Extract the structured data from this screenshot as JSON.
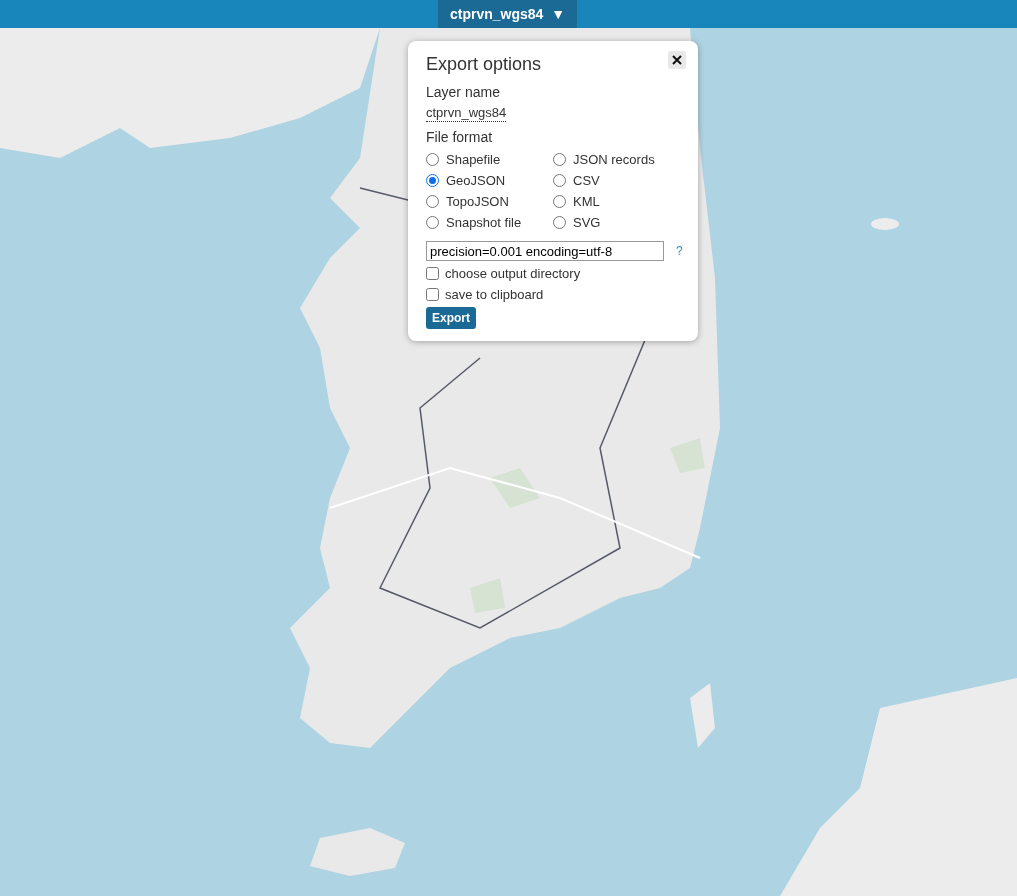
{
  "top_bar": {
    "layer_name": "ctprvn_wgs84",
    "menu_caret": "▼"
  },
  "export_dialog": {
    "title": "Export options",
    "layer_name_label": "Layer name",
    "layer_name": "ctprvn_wgs84",
    "file_format_label": "File format",
    "formats": [
      {
        "label": "Shapefile",
        "selected": false
      },
      {
        "label": "JSON records",
        "selected": false
      },
      {
        "label": "GeoJSON",
        "selected": true
      },
      {
        "label": "CSV",
        "selected": false
      },
      {
        "label": "TopoJSON",
        "selected": false
      },
      {
        "label": "KML",
        "selected": false
      },
      {
        "label": "Snapshot file",
        "selected": false
      },
      {
        "label": "SVG",
        "selected": false
      }
    ],
    "options_value": "precision=0.001 encoding=utf-8",
    "help": "?",
    "checkboxes": [
      {
        "label": "choose output directory",
        "checked": false
      },
      {
        "label": "save to clipboard",
        "checked": false
      }
    ],
    "export_button": "Export"
  }
}
